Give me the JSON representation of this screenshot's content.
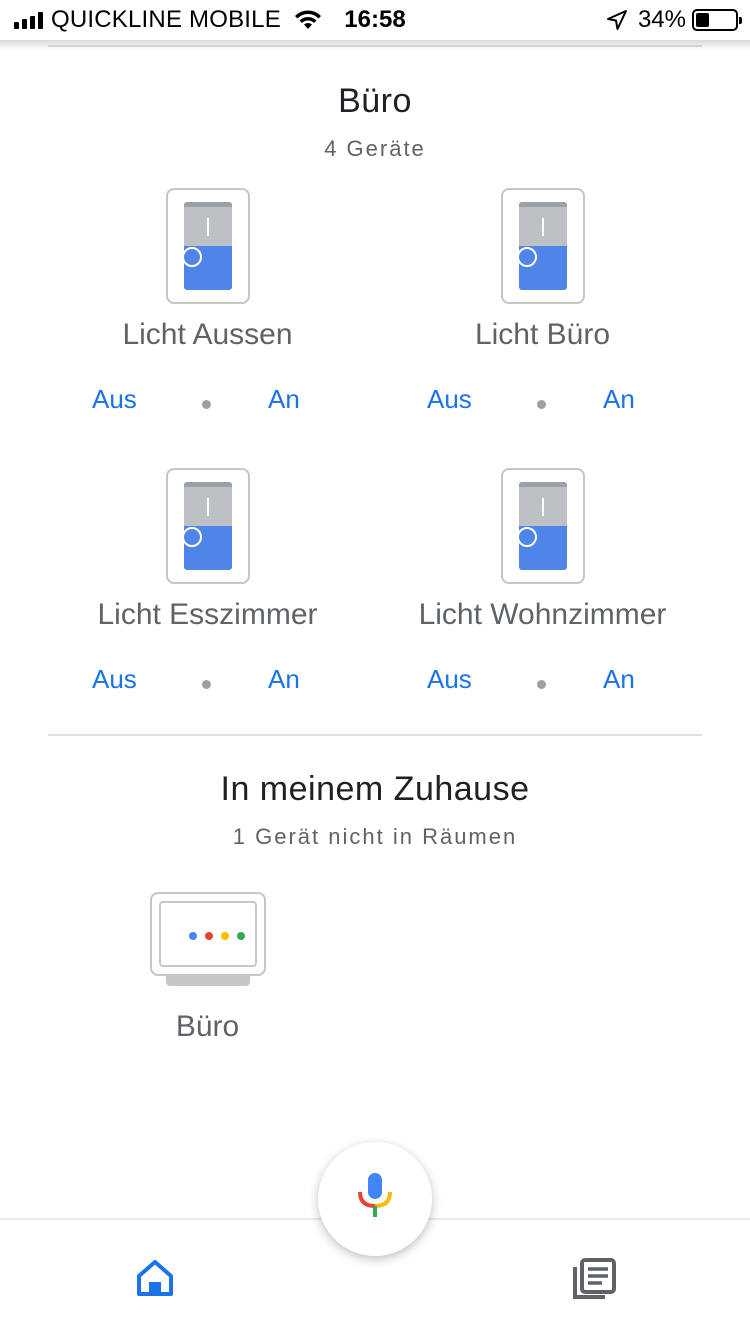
{
  "status_bar": {
    "carrier": "QUICKLINE MOBILE",
    "time": "16:58",
    "battery_percent": "34%",
    "battery_level": 0.34
  },
  "room": {
    "title": "Büro",
    "subtitle": "4 Geräte",
    "devices": [
      {
        "name": "Licht Aussen",
        "off_label": "Aus",
        "on_label": "An",
        "icon": "light-switch-icon"
      },
      {
        "name": "Licht Büro",
        "off_label": "Aus",
        "on_label": "An",
        "icon": "light-switch-icon"
      },
      {
        "name": "Licht Esszimmer",
        "off_label": "Aus",
        "on_label": "An",
        "icon": "light-switch-icon"
      },
      {
        "name": "Licht Wohnzimmer",
        "off_label": "Aus",
        "on_label": "An",
        "icon": "light-switch-icon"
      }
    ]
  },
  "home_section": {
    "title": "In meinem Zuhause",
    "subtitle": "1 Gerät nicht in Räumen",
    "device": {
      "name": "Büro",
      "icon": "smart-display-icon"
    }
  },
  "google_colors": {
    "blue": "#4285f4",
    "red": "#ea4335",
    "yellow": "#fbbc05",
    "green": "#34a853"
  },
  "bottom_nav": {
    "items": [
      {
        "icon": "home-icon",
        "active": true
      },
      {
        "icon": "feed-icon",
        "active": false
      }
    ],
    "center_icon": "mic-icon"
  },
  "colors": {
    "accent": "#1a73e8",
    "switch_on": "#4f84e8"
  }
}
